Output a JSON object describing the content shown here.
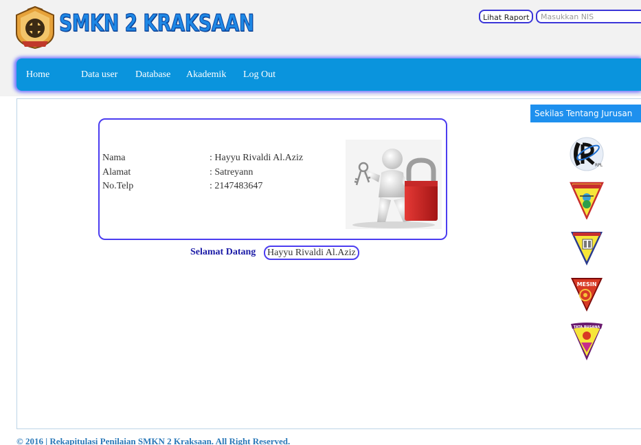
{
  "header": {
    "brand": "SMKN 2 KRAKSAAN",
    "raport_button": "Lihat Raport",
    "nis_placeholder": "Masukkan NIS"
  },
  "nav": {
    "items": [
      {
        "label": "Home"
      },
      {
        "label": "Data user"
      },
      {
        "label": "Database"
      },
      {
        "label": "Akademik"
      },
      {
        "label": "Log Out"
      }
    ]
  },
  "profile": {
    "rows": [
      {
        "label": "Nama",
        "value": ": Hayyu Rivaldi Al.Aziz"
      },
      {
        "label": "Alamat",
        "value": ": Satreyann"
      },
      {
        "label": "No.Telp",
        "value": ": 2147483647"
      }
    ]
  },
  "welcome": {
    "label": "Selamat Datang",
    "name": "Hayyu Rivaldi Al.Aziz"
  },
  "sidebar": {
    "header": "Sekilas Tentang Jurusan",
    "badges": [
      {
        "icon": "rpl-logo-icon"
      },
      {
        "icon": "jurusan-badge-2-icon"
      },
      {
        "icon": "jurusan-badge-3-icon"
      },
      {
        "icon": "mesin-badge-icon",
        "text": "MESIN"
      },
      {
        "icon": "tata-busana-badge-icon",
        "text": "TATA BUSANA"
      }
    ]
  },
  "footer": {
    "text": "© 2016 | Rekapitulasi Penilaian SMKN 2 Kraksaan. All Right Reserved."
  },
  "colors": {
    "nav": "#0a94dd",
    "accent_border": "#4b3cf0",
    "sidebar_header": "#1e90ee",
    "footer_text": "#2a78b8"
  }
}
